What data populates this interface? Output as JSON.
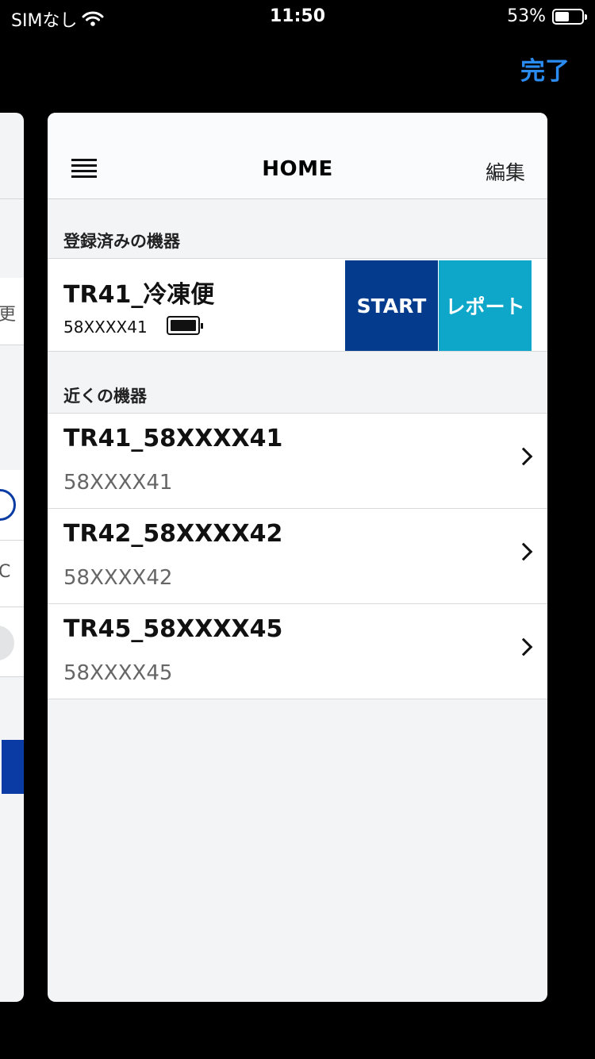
{
  "status_bar": {
    "carrier": "SIMなし",
    "time": "11:50",
    "battery_percent": "53%",
    "battery_level": 0.53
  },
  "top": {
    "done_label": "完了"
  },
  "left_card_fragments": {
    "text_1": "更",
    "text_2": "C"
  },
  "navbar": {
    "title": "HOME",
    "edit_label": "編集"
  },
  "registered": {
    "section_title": "登録済みの機器",
    "device_name": "TR41_冷凍便",
    "device_id": "58XXXX41",
    "start_label": "START",
    "report_label": "レポート"
  },
  "nearby": {
    "section_title": "近くの機器",
    "items": [
      {
        "name": "TR41_58XXXX41",
        "id": "58XXXX41"
      },
      {
        "name": "TR42_58XXXX42",
        "id": "58XXXX42"
      },
      {
        "name": "TR45_58XXXX45",
        "id": "58XXXX45"
      }
    ]
  },
  "colors": {
    "accent_link": "#2a8cf0",
    "start_button": "#053b8c",
    "report_button": "#0ea6c9"
  }
}
